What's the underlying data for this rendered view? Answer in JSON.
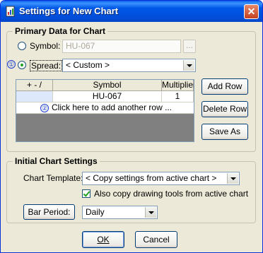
{
  "window": {
    "title": "Settings for New Chart",
    "close_glyph": "✕",
    "icon": "chart-settings-icon"
  },
  "primary": {
    "legend": "Primary Data for Chart",
    "symbol_label": "Symbol:",
    "symbol_value": "HU-067",
    "browse_label": "...",
    "spread_label": "Spread:",
    "spread_value": "< Custom >",
    "badge1": "①",
    "grid": {
      "headers": [
        "+ - /",
        "Symbol",
        "Multiplier"
      ],
      "rows": [
        {
          "op": "",
          "symbol": "HU-067",
          "multiplier": "1"
        }
      ],
      "badge2": "②",
      "add_row_text": "Click here to add another row ..."
    },
    "add_row_button": "Add Row",
    "delete_row_button": "Delete Row",
    "save_as_button": "Save As"
  },
  "initial": {
    "legend": "Initial Chart Settings",
    "template_label": "Chart Template:",
    "template_value": "< Copy settings from active chart >",
    "copy_tools_label": "Also copy drawing tools from active chart",
    "copy_tools_checked": true,
    "bar_period_button": "Bar Period:",
    "bar_period_value": "Daily"
  },
  "footer": {
    "ok_button": "OK",
    "cancel_button": "Cancel"
  }
}
